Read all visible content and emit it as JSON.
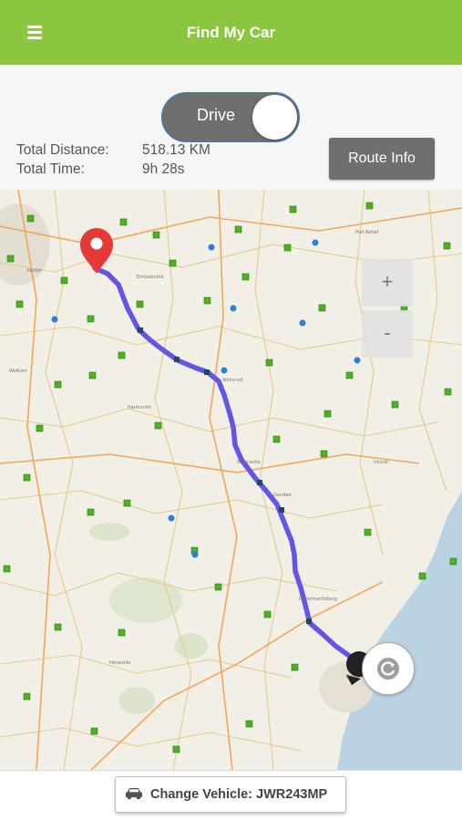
{
  "appbar": {
    "title": "Find My Car",
    "menu_icon": "hamburger-menu-icon",
    "color": "#8cc63f"
  },
  "mode_toggle": {
    "label": "Drive",
    "state": "on"
  },
  "stats": {
    "distance_label": "Total Distance:",
    "distance_value": "518.13 KM",
    "time_label": "Total Time:",
    "time_value": "9h 28s"
  },
  "route_info_button": {
    "label": "Route Info"
  },
  "map": {
    "zoom_in_label": "+",
    "zoom_out_label": "-",
    "route_color": "#6355e6",
    "marker_color": "#e53935",
    "start_marker_icon": "map-pin-icon",
    "recenter_icon": "recenter-icon"
  },
  "footer": {
    "vehicle_label": "Change Vehicle: JWR243MP",
    "vehicle_icon": "car-icon"
  }
}
